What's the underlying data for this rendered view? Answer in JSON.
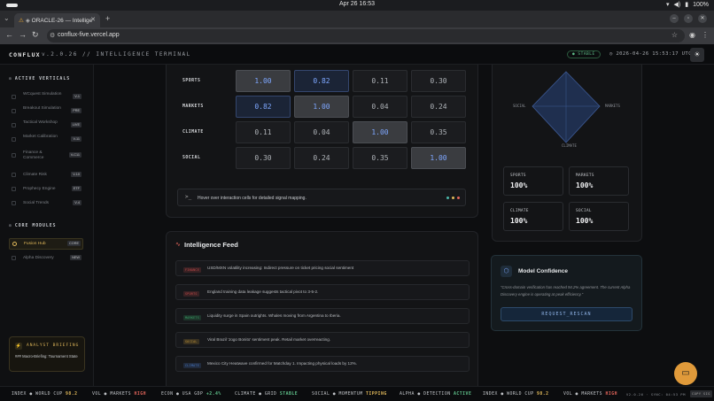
{
  "os": {
    "clock": "Apr 26  16:53",
    "battery": "100%"
  },
  "browser": {
    "tab_title": "ORACLE-26 — Intellige",
    "url": "conflux-five.vercel.app"
  },
  "header": {
    "brand": "CONFLUX",
    "subtitle": "v.2.0.26 // INTELLIGENCE TERMINAL",
    "status": "STABLE",
    "timestamp": "2026-04-26 15:53:17 UTC"
  },
  "sidebar": {
    "active_verticals_title": "ACTIVE VERTICALS",
    "verticals": [
      {
        "label": "WCquest Simulation",
        "badge": "V-1"
      },
      {
        "label": "Breakout Simulation",
        "badge": "PRE"
      },
      {
        "label": "Tactical Workshop",
        "badge": "LIVE"
      },
      {
        "label": "Market Calibration",
        "badge": "V-11"
      },
      {
        "label": "Finance & Commerce",
        "badge": "V-C11"
      },
      {
        "label": "Climate Risk",
        "badge": "V-10"
      },
      {
        "label": "Prophecy Engine",
        "badge": "ETF"
      },
      {
        "label": "Social Trends",
        "badge": "V-4"
      }
    ],
    "core_modules_title": "CORE MODULES",
    "modules": [
      {
        "label": "Fusion Hub",
        "badge": "CORE"
      },
      {
        "label": "Alpha Discovery",
        "badge": "NEW"
      }
    ],
    "briefing": {
      "title": "ANALYST BRIEFING",
      "text": "### Macro-Briefing: Tournament State"
    }
  },
  "matrix": {
    "rows": [
      {
        "label": "SPORTS",
        "values": [
          "1.00",
          "0.82",
          "0.11",
          "0.30"
        ]
      },
      {
        "label": "MARKETS",
        "values": [
          "0.82",
          "1.00",
          "0.04",
          "0.24"
        ]
      },
      {
        "label": "CLIMATE",
        "values": [
          "0.11",
          "0.04",
          "1.00",
          "0.35"
        ]
      },
      {
        "label": "SOCIAL",
        "values": [
          "0.30",
          "0.24",
          "0.35",
          "1.00"
        ]
      }
    ],
    "console_prompt": ">_",
    "console_msg": "Hover over interaction cells for detailed signal mapping."
  },
  "radar": {
    "axes": [
      "SPORTS",
      "MARKETS",
      "CLIMATE",
      "SOCIAL"
    ],
    "colors": {
      "fill": "#1f2f4f",
      "stroke": "#3d5a95"
    }
  },
  "stats": [
    {
      "label": "SPORTS",
      "value": "100%"
    },
    {
      "label": "MARKETS",
      "value": "100%"
    },
    {
      "label": "CLIMATE",
      "value": "100%"
    },
    {
      "label": "SOCIAL",
      "value": "100%"
    }
  ],
  "feed": {
    "title": "Intelligence Feed",
    "items": [
      {
        "tag": "FINANCE",
        "color": "#c84a4a",
        "text": "USD/MXN volatility increasing: Indirect pressure on ticket pricing social sentiment"
      },
      {
        "tag": "SPORTS",
        "color": "#c84a4a",
        "text": "England training data leakage suggests tactical pivot to 3-5-2."
      },
      {
        "tag": "MARKETS",
        "color": "#3aa66a",
        "text": "Liquidity surge in Spain outrights. Whales moving from Argentina to Iberia."
      },
      {
        "tag": "SOCIAL",
        "color": "#c99a3a",
        "text": "Viral Brazil 'Jogo Bonito' sentiment peak. Retail market overreacting."
      },
      {
        "tag": "CLIMATE",
        "color": "#4a7ac8",
        "text": "Mexico City Heatwave confirmed for Matchday 1. Impacting physical loads by 12%."
      }
    ]
  },
  "confidence": {
    "title": "Model Confidence",
    "text": "\"Cross-domain verification has reached 94.2% agreement. The current Alpha Discovery engine is operating at peak efficiency.\"",
    "button": "REQUEST_RESCAN"
  },
  "ticker": [
    {
      "label": "INDEX ● WORLD CUP",
      "value": "98.2",
      "color": "#e0b85a"
    },
    {
      "label": "VOL ● MARKETS",
      "value": "HIGH",
      "color": "#e0645a"
    },
    {
      "label": "ECON ● USA GDP",
      "value": "+2.4%",
      "color": "#5fc08a"
    },
    {
      "label": "CLIMATE ● GRID",
      "value": "STABLE",
      "color": "#5fc08a"
    },
    {
      "label": "SOCIAL ● MOMENTUM",
      "value": "TIPPING",
      "color": "#e0b85a"
    },
    {
      "label": "ALPHA ● DETECTION",
      "value": "ACTIVE",
      "color": "#5fc08a"
    },
    {
      "label": "INDEX ● WORLD CUP",
      "value": "98.2",
      "color": "#e0b85a"
    },
    {
      "label": "VOL ● MARKETS",
      "value": "HIGH",
      "color": "#e0645a"
    }
  ],
  "ticker_right": "V2.0.26 · SYNC: 04:53 PM",
  "ticker_badge": "COPY SIG"
}
